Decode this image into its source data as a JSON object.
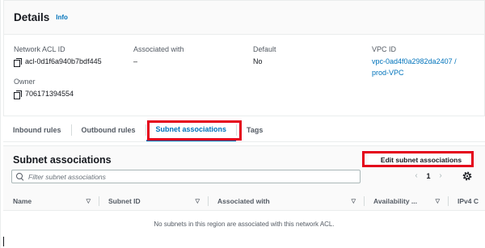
{
  "details": {
    "title": "Details",
    "info_link": "Info",
    "network_acl_id": {
      "label": "Network ACL ID",
      "value": "acl-0d1f6a940b7bdf445"
    },
    "associated_with": {
      "label": "Associated with",
      "value": "–"
    },
    "default": {
      "label": "Default",
      "value": "No"
    },
    "vpc_id": {
      "label": "VPC ID",
      "value_line1": "vpc-0ad4f0a2982da2407 /",
      "value_line2": "prod-VPC"
    },
    "owner": {
      "label": "Owner",
      "value": "706171394554"
    }
  },
  "tabs": [
    {
      "label": "Inbound rules"
    },
    {
      "label": "Outbound rules"
    },
    {
      "label": "Subnet associations",
      "active": true
    },
    {
      "label": "Tags"
    }
  ],
  "subnet_associations": {
    "title": "Subnet associations",
    "edit_button": "Edit subnet associations",
    "filter_placeholder": "Filter subnet associations",
    "pagination": {
      "prev": "‹",
      "page": "1",
      "next": "›"
    },
    "columns": [
      "Name",
      "Subnet ID",
      "Associated with",
      "Availability ...",
      "IPv4 C"
    ],
    "empty_message": "No subnets in this region are associated with this network ACL."
  },
  "icons": {
    "copy": "copy-icon",
    "search": "search-icon",
    "settings": "gear-icon",
    "sort": "sort-icon"
  },
  "colors": {
    "link": "#0073bb",
    "highlight": "#e4001b",
    "text": "#16191f",
    "muted": "#545b64"
  }
}
